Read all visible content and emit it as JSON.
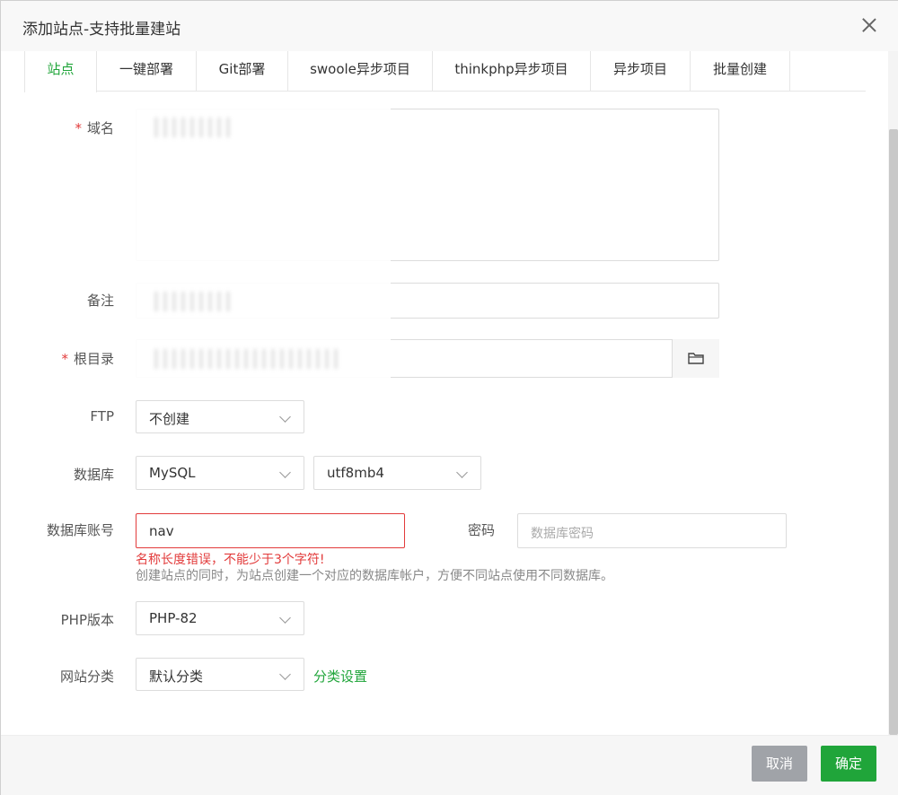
{
  "dialog": {
    "title": "添加站点-支持批量建站"
  },
  "tabs": [
    {
      "label": "站点"
    },
    {
      "label": "一键部署"
    },
    {
      "label": "Git部署"
    },
    {
      "label": "swoole异步项目"
    },
    {
      "label": "thinkphp异步项目"
    },
    {
      "label": "异步项目"
    },
    {
      "label": "批量创建"
    }
  ],
  "form": {
    "domain": {
      "label": "域名",
      "required": "*"
    },
    "remark": {
      "label": "备注"
    },
    "root": {
      "label": "根目录",
      "required": "*"
    },
    "ftp": {
      "label": "FTP",
      "value": "不创建"
    },
    "database": {
      "label": "数据库",
      "type": "MySQL",
      "charset": "utf8mb4"
    },
    "db_account": {
      "label": "数据库账号",
      "value": "nav",
      "error": "名称长度错误，不能少于3个字符!",
      "help": "创建站点的同时，为站点创建一个对应的数据库帐户，方便不同站点使用不同数据库。"
    },
    "password": {
      "label": "密码",
      "placeholder": "数据库密码"
    },
    "php": {
      "label": "PHP版本",
      "value": "PHP-82"
    },
    "category": {
      "label": "网站分类",
      "value": "默认分类",
      "settings_link": "分类设置"
    }
  },
  "footer": {
    "cancel_label": "取消",
    "ok_label": "确定"
  },
  "colors": {
    "accent": "#20a53a",
    "error": "#e23b3b"
  },
  "icons": {
    "close": "close-icon",
    "folder": "folder-icon",
    "dropdown": "chevron-down-icon"
  }
}
